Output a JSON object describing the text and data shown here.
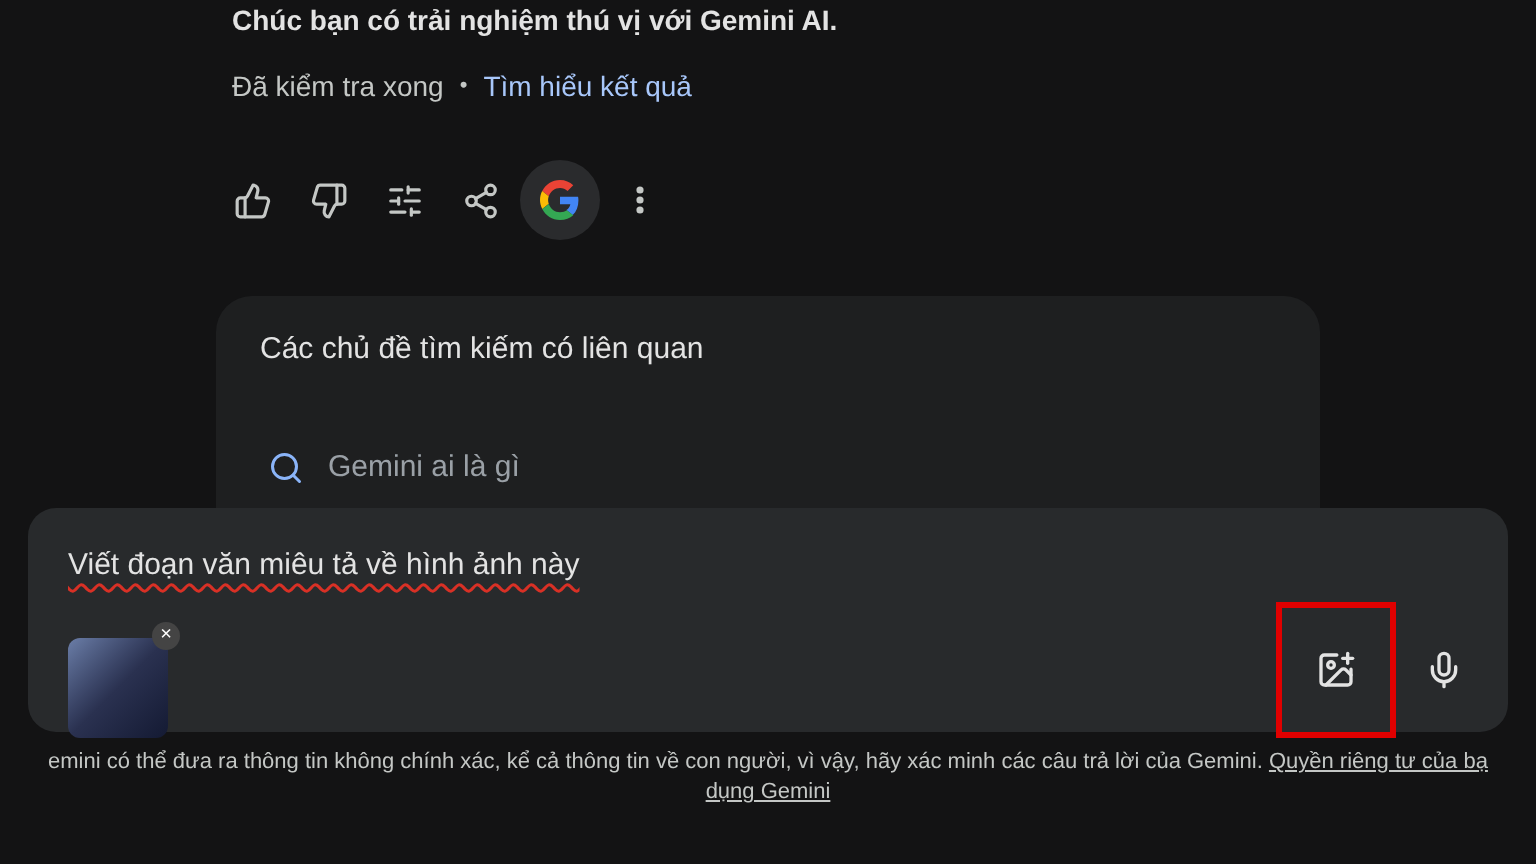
{
  "response": {
    "last_line": "Chúc bạn có trải nghiệm thú vị với Gemini AI.",
    "check_status": "Đã kiểm tra xong",
    "separator": "•",
    "check_link": "Tìm hiểu kết quả"
  },
  "actions": [
    {
      "kind": "like"
    },
    {
      "kind": "dislike"
    },
    {
      "kind": "tune"
    },
    {
      "kind": "share"
    },
    {
      "kind": "google"
    },
    {
      "kind": "more"
    }
  ],
  "related": {
    "title": "Các chủ đề tìm kiếm có liên quan",
    "items": [
      "Gemini ai là gì"
    ]
  },
  "prompt": {
    "value": "Viết đoạn văn miêu tả về hình ảnh này",
    "attachment_remove": "×",
    "image_button_highlighted": true
  },
  "footer": {
    "text": "emini có thể đưa ra thông tin không chính xác, kể cả thông tin về con người, vì vậy, hãy xác minh các câu trả lời của Gemini.",
    "link_parts": [
      "Quyền riêng tư của bạ",
      "dụng Gemini"
    ]
  }
}
